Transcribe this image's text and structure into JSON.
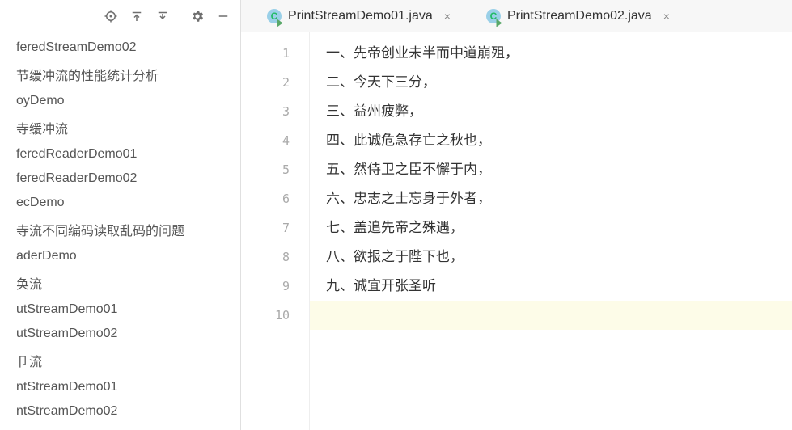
{
  "colors": {
    "java_icon": "#9ad0e8",
    "runmark": "#59a869"
  },
  "sidebar": {
    "items": [
      {
        "label": "feredStreamDemo02"
      },
      {
        "label": "节缓冲流的性能统计分析"
      },
      {
        "label": "oyDemo"
      },
      {
        "label": "寺缓冲流"
      },
      {
        "label": "feredReaderDemo01"
      },
      {
        "label": "feredReaderDemo02"
      },
      {
        "label": "ecDemo"
      },
      {
        "label": "寺流不同编码读取乱码的问题"
      },
      {
        "label": "aderDemo"
      },
      {
        "label": "奂流"
      },
      {
        "label": "utStreamDemo01"
      },
      {
        "label": "utStreamDemo02"
      },
      {
        "label": "卩流"
      },
      {
        "label": "ntStreamDemo01"
      },
      {
        "label": "ntStreamDemo02"
      }
    ]
  },
  "tabs": [
    {
      "label": "PrintStreamDemo01.java"
    },
    {
      "label": "PrintStreamDemo02.java"
    }
  ],
  "editor": {
    "lines": [
      {
        "num": "1",
        "text": "一、先帝创业未半而中道崩殂，"
      },
      {
        "num": "2",
        "text": "二、今天下三分，"
      },
      {
        "num": "3",
        "text": "三、益州疲弊，"
      },
      {
        "num": "4",
        "text": "四、此诚危急存亡之秋也，"
      },
      {
        "num": "5",
        "text": "五、然侍卫之臣不懈于内，"
      },
      {
        "num": "6",
        "text": "六、忠志之士忘身于外者，"
      },
      {
        "num": "7",
        "text": "七、盖追先帝之殊遇，"
      },
      {
        "num": "8",
        "text": "八、欲报之于陛下也，"
      },
      {
        "num": "9",
        "text": "九、诚宜开张圣听"
      },
      {
        "num": "10",
        "text": ""
      }
    ]
  }
}
